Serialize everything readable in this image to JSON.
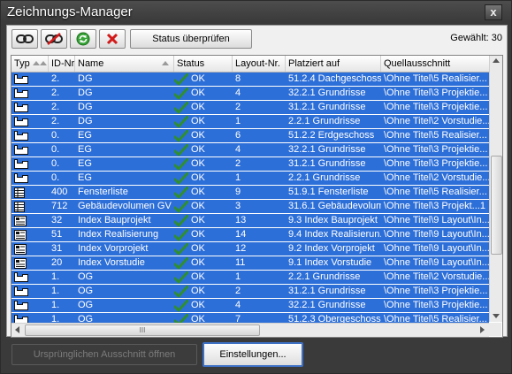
{
  "window": {
    "title": "Zeichnungs-Manager",
    "close_glyph": "x"
  },
  "toolbar": {
    "buttons": [
      {
        "icon": "link-icon"
      },
      {
        "icon": "unlink-icon"
      },
      {
        "icon": "refresh-icon"
      },
      {
        "icon": "delete-icon"
      }
    ],
    "status_button": "Status überprüfen",
    "selected_label": "Gewählt: 30"
  },
  "columns": [
    "Typ",
    "ID-Nr.",
    "Name",
    "Status",
    "Layout-Nr.",
    "Platziert auf",
    "Quellausschnitt"
  ],
  "rows": [
    {
      "type": "drawing",
      "id": "2.",
      "name": "DG",
      "status": "OK",
      "layout": "8",
      "placed": "51.2.4 Dachgeschoss",
      "source": "\\Ohne Titel\\5 Realisier..."
    },
    {
      "type": "drawing",
      "id": "2.",
      "name": "DG",
      "status": "OK",
      "layout": "4",
      "placed": "32.2.1 Grundrisse",
      "source": "\\Ohne Titel\\3 Projektie..."
    },
    {
      "type": "drawing",
      "id": "2.",
      "name": "DG",
      "status": "OK",
      "layout": "2",
      "placed": "31.2.1 Grundrisse",
      "source": "\\Ohne Titel\\3 Projektie..."
    },
    {
      "type": "drawing",
      "id": "2.",
      "name": "DG",
      "status": "OK",
      "layout": "1",
      "placed": "2.2.1 Grundrisse",
      "source": "\\Ohne Titel\\2 Vorstudie..."
    },
    {
      "type": "drawing",
      "id": "0.",
      "name": "EG",
      "status": "OK",
      "layout": "6",
      "placed": "51.2.2 Erdgeschoss",
      "source": "\\Ohne Titel\\5 Realisier..."
    },
    {
      "type": "drawing",
      "id": "0.",
      "name": "EG",
      "status": "OK",
      "layout": "4",
      "placed": "32.2.1 Grundrisse",
      "source": "\\Ohne Titel\\3 Projektie..."
    },
    {
      "type": "drawing",
      "id": "0.",
      "name": "EG",
      "status": "OK",
      "layout": "2",
      "placed": "31.2.1 Grundrisse",
      "source": "\\Ohne Titel\\3 Projektie..."
    },
    {
      "type": "drawing",
      "id": "0.",
      "name": "EG",
      "status": "OK",
      "layout": "1",
      "placed": "2.2.1 Grundrisse",
      "source": "\\Ohne Titel\\2 Vorstudie..."
    },
    {
      "type": "list",
      "id": "400",
      "name": "Fensterliste",
      "status": "OK",
      "layout": "9",
      "placed": "51.9.1 Fensterliste",
      "source": "\\Ohne Titel\\5 Realisier..."
    },
    {
      "type": "list",
      "id": "712",
      "name": "Gebäudevolumen GV",
      "status": "OK",
      "layout": "3",
      "placed": "31.6.1 Gebäudevolum...",
      "source": "\\Ohne Titel\\3 Projekt...1"
    },
    {
      "type": "index",
      "id": "32",
      "name": "Index Bauprojekt",
      "status": "OK",
      "layout": "13",
      "placed": "9.3 Index Bauprojekt",
      "source": "\\Ohne Titel\\9 Layout\\In..."
    },
    {
      "type": "index",
      "id": "51",
      "name": "Index Realisierung",
      "status": "OK",
      "layout": "14",
      "placed": "9.4 Index Realisierun...",
      "source": "\\Ohne Titel\\9 Layout\\In..."
    },
    {
      "type": "index",
      "id": "31",
      "name": "Index Vorprojekt",
      "status": "OK",
      "layout": "12",
      "placed": "9.2 Index Vorprojekt",
      "source": "\\Ohne Titel\\9 Layout\\In..."
    },
    {
      "type": "index",
      "id": "20",
      "name": "Index Vorstudie",
      "status": "OK",
      "layout": "11",
      "placed": "9.1 Index Vorstudie",
      "source": "\\Ohne Titel\\9 Layout\\In..."
    },
    {
      "type": "drawing",
      "id": "1.",
      "name": "OG",
      "status": "OK",
      "layout": "1",
      "placed": "2.2.1 Grundrisse",
      "source": "\\Ohne Titel\\2 Vorstudie..."
    },
    {
      "type": "drawing",
      "id": "1.",
      "name": "OG",
      "status": "OK",
      "layout": "2",
      "placed": "31.2.1 Grundrisse",
      "source": "\\Ohne Titel\\3 Projektie..."
    },
    {
      "type": "drawing",
      "id": "1.",
      "name": "OG",
      "status": "OK",
      "layout": "4",
      "placed": "32.2.1 Grundrisse",
      "source": "\\Ohne Titel\\3 Projektie..."
    },
    {
      "type": "drawing",
      "id": "1.",
      "name": "OG",
      "status": "OK",
      "layout": "7",
      "placed": "51.2.3 Obergeschoss",
      "source": "\\Ohne Titel\\5 Realisier..."
    }
  ],
  "hscroll_grip": "III",
  "footer": {
    "open_button": "Ursprünglichen Ausschnitt öffnen",
    "settings_button": "Einstellungen..."
  },
  "colors": {
    "selection": "#2d6fd8",
    "check": "#2f8f2f",
    "window": "#3a3a3a"
  }
}
